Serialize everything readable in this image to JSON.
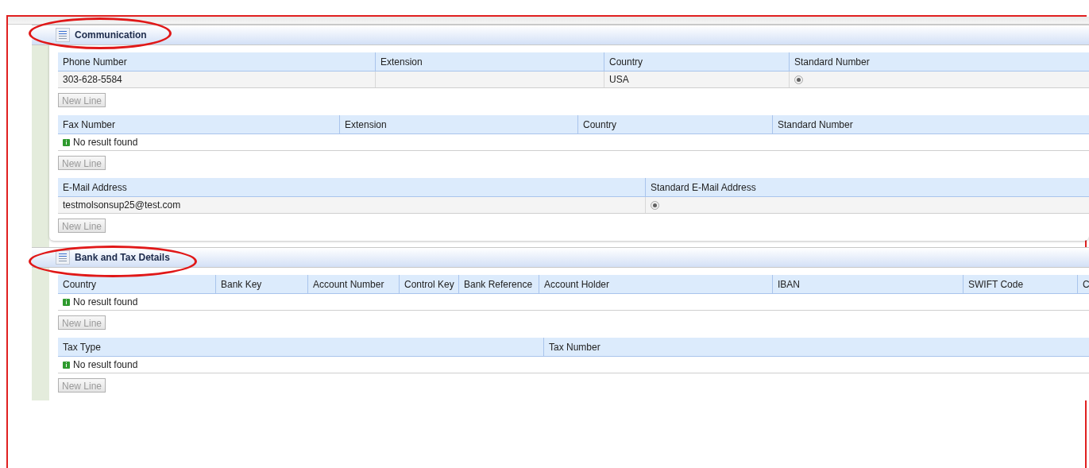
{
  "sections": [
    {
      "title": "Communication",
      "tables": [
        {
          "columns": [
            "Phone Number",
            "Extension",
            "Country",
            "Standard Number"
          ],
          "rows": [
            {
              "cells": [
                {
                  "kind": "text",
                  "text": "303-628-5584"
                },
                {
                  "kind": "empty"
                },
                {
                  "kind": "text",
                  "text": "USA"
                },
                {
                  "kind": "radio",
                  "selected": true
                }
              ]
            }
          ],
          "button": {
            "label": "New Line",
            "disabled": true
          }
        },
        {
          "columns": [
            "Fax Number",
            "Extension",
            "Country",
            "Standard Number"
          ],
          "message": "No result found",
          "button": {
            "label": "New Line",
            "disabled": true
          }
        },
        {
          "columns": [
            "E-Mail Address",
            "Standard E-Mail Address"
          ],
          "rows": [
            {
              "cells": [
                {
                  "kind": "text",
                  "text": "testmolsonsup25@test.com"
                },
                {
                  "kind": "radio",
                  "selected": true
                }
              ]
            }
          ],
          "button": {
            "label": "New Line",
            "disabled": true
          }
        }
      ]
    },
    {
      "title": "Bank and Tax Details",
      "tables": [
        {
          "columns": [
            "Country",
            "Bank Key",
            "Account Number",
            "Control Key",
            "Bank Reference",
            "Account Holder",
            "IBAN",
            "SWIFT Code",
            "C"
          ],
          "message": "No result found",
          "button": {
            "label": "New Line",
            "disabled": true
          }
        },
        {
          "columns": [
            "Tax Type",
            "Tax Number"
          ],
          "message": "No result found",
          "button": {
            "label": "New Line",
            "disabled": true
          }
        }
      ]
    }
  ]
}
